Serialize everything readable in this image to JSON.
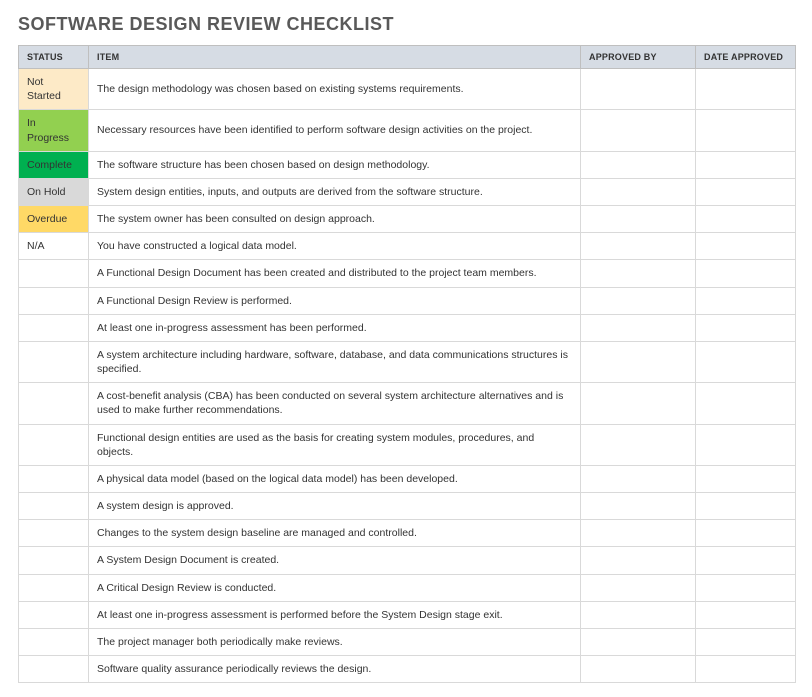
{
  "title": "SOFTWARE DESIGN REVIEW CHECKLIST",
  "columns": {
    "status": "STATUS",
    "item": "ITEM",
    "approved_by": "APPROVED BY",
    "date_approved": "DATE APPROVED"
  },
  "status_labels": {
    "not_started": "Not Started",
    "in_progress": "In Progress",
    "complete": "Complete",
    "on_hold": "On Hold",
    "overdue": "Overdue",
    "na": "N/A"
  },
  "rows": [
    {
      "status_key": "not_started",
      "item": "The design methodology was chosen based on existing systems requirements.",
      "approved_by": "",
      "date_approved": ""
    },
    {
      "status_key": "in_progress",
      "item": "Necessary resources have been identified to perform software design activities on the project.",
      "approved_by": "",
      "date_approved": ""
    },
    {
      "status_key": "complete",
      "item": "The software structure has been chosen based on design methodology.",
      "approved_by": "",
      "date_approved": ""
    },
    {
      "status_key": "on_hold",
      "item": "System design entities, inputs, and outputs are derived from the software structure.",
      "approved_by": "",
      "date_approved": ""
    },
    {
      "status_key": "overdue",
      "item": "The system owner has been consulted on design approach.",
      "approved_by": "",
      "date_approved": ""
    },
    {
      "status_key": "na",
      "item": "You have constructed a logical data model.",
      "approved_by": "",
      "date_approved": ""
    },
    {
      "status_key": "",
      "item": "A Functional Design Document has been created and distributed to the project team members.",
      "approved_by": "",
      "date_approved": ""
    },
    {
      "status_key": "",
      "item": "A Functional Design Review is performed.",
      "approved_by": "",
      "date_approved": ""
    },
    {
      "status_key": "",
      "item": "At least one in-progress assessment has been performed.",
      "approved_by": "",
      "date_approved": ""
    },
    {
      "status_key": "",
      "item": "A system architecture including hardware, software, database, and data communications structures is specified.",
      "approved_by": "",
      "date_approved": ""
    },
    {
      "status_key": "",
      "item": "A cost-benefit analysis (CBA) has been conducted on several system architecture alternatives and is used to make further recommendations.",
      "approved_by": "",
      "date_approved": ""
    },
    {
      "status_key": "",
      "item": "Functional design entities are used as the basis for creating system modules, procedures, and objects.",
      "approved_by": "",
      "date_approved": ""
    },
    {
      "status_key": "",
      "item": "A physical data model (based on the logical data model) has been developed.",
      "approved_by": "",
      "date_approved": ""
    },
    {
      "status_key": "",
      "item": "A system design is approved.",
      "approved_by": "",
      "date_approved": ""
    },
    {
      "status_key": "",
      "item": "Changes to the system design baseline are managed and controlled.",
      "approved_by": "",
      "date_approved": ""
    },
    {
      "status_key": "",
      "item": "A System Design Document is created.",
      "approved_by": "",
      "date_approved": ""
    },
    {
      "status_key": "",
      "item": "A Critical Design Review is conducted.",
      "approved_by": "",
      "date_approved": ""
    },
    {
      "status_key": "",
      "item": "At least one in-progress assessment is performed before the System Design stage exit.",
      "approved_by": "",
      "date_approved": ""
    },
    {
      "status_key": "",
      "item": "The project manager both periodically make reviews.",
      "approved_by": "",
      "date_approved": ""
    },
    {
      "status_key": "",
      "item": "Software quality assurance periodically reviews the design.",
      "approved_by": "",
      "date_approved": ""
    }
  ]
}
